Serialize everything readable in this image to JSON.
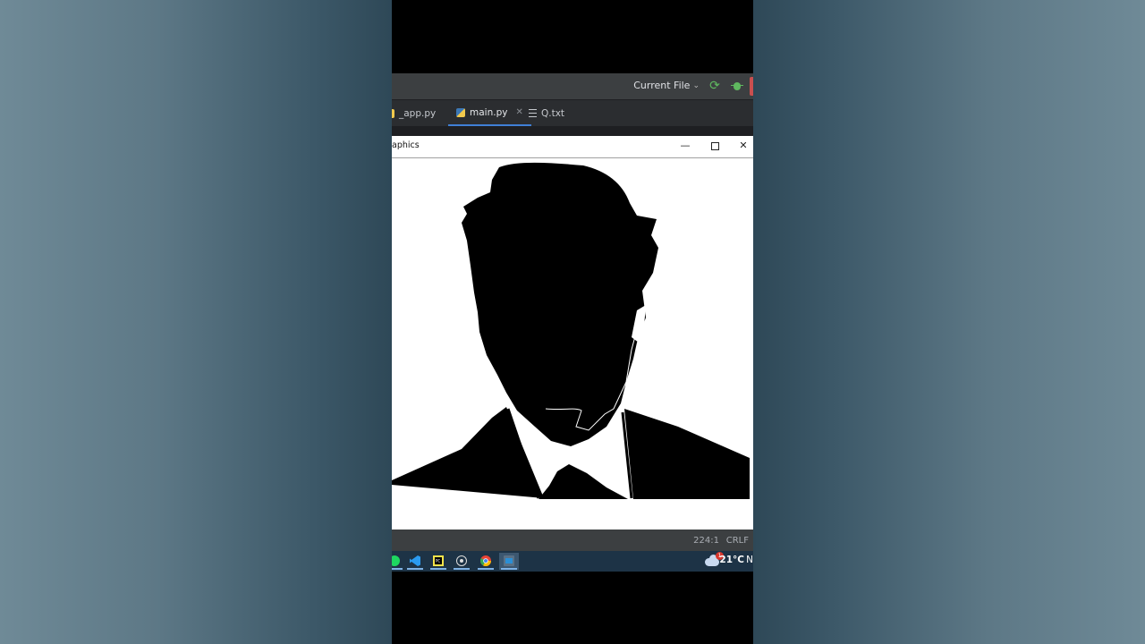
{
  "toolbar": {
    "run_config": "Current File"
  },
  "tabs": [
    {
      "label": "_app.py",
      "icon": "python-icon"
    },
    {
      "label": "main.py",
      "icon": "python-icon",
      "active": true
    },
    {
      "label": "Q.txt",
      "icon": "text-file-icon"
    }
  ],
  "graphics_window": {
    "title": "aphics",
    "controls": {
      "minimize": "—",
      "close": "✕"
    }
  },
  "statusbar": {
    "position": "224:1",
    "line_ending": "CRLF"
  },
  "taskbar": {
    "apps": [
      "spotify-icon",
      "vscode-icon",
      "pycharm-icon",
      "obs-icon",
      "chrome-icon",
      "python-window-icon"
    ],
    "weather": {
      "temp": "21°C",
      "badge": "1",
      "overflow": "N"
    }
  },
  "colors": {
    "accent": "#3f7fd6",
    "run_green": "#5fb85f",
    "stop_red": "#c94f4f"
  }
}
